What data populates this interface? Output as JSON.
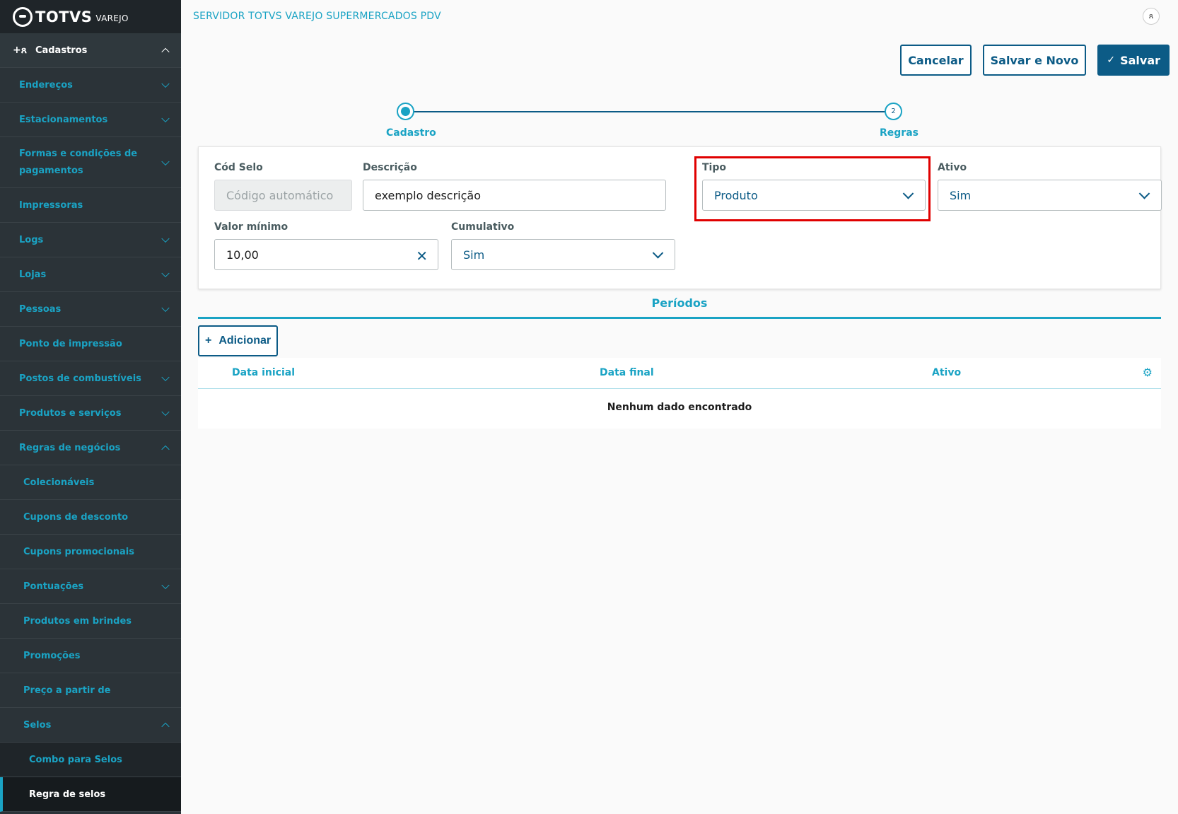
{
  "brand": {
    "name": "TOTVS",
    "sub": "VAREJO"
  },
  "header": {
    "title": "SERVIDOR TOTVS VAREJO SUPERMERCADOS PDV"
  },
  "sidebar": {
    "section": "Cadastros",
    "items": [
      {
        "label": "Endereços"
      },
      {
        "label": "Estacionamentos"
      },
      {
        "label": "Formas e condições de pagamentos"
      },
      {
        "label": "Impressoras"
      },
      {
        "label": "Logs"
      },
      {
        "label": "Lojas"
      },
      {
        "label": "Pessoas"
      },
      {
        "label": "Ponto de impressão"
      },
      {
        "label": "Postos de combustíveis"
      },
      {
        "label": "Produtos e serviços"
      },
      {
        "label": "Regras de negócios"
      }
    ],
    "sub_items": [
      {
        "label": "Colecionáveis"
      },
      {
        "label": "Cupons de desconto"
      },
      {
        "label": "Cupons promocionais"
      },
      {
        "label": "Pontuações"
      },
      {
        "label": "Produtos em brindes"
      },
      {
        "label": "Promoções"
      },
      {
        "label": "Preço a partir de"
      },
      {
        "label": "Selos"
      }
    ],
    "sub2_items": [
      {
        "label": "Combo para Selos"
      },
      {
        "label": "Regra de selos"
      }
    ]
  },
  "actions": {
    "cancel": "Cancelar",
    "save_new": "Salvar e Novo",
    "save": "Salvar"
  },
  "stepper": {
    "step1": "Cadastro",
    "step2": "Regras",
    "step2_number": "2"
  },
  "form": {
    "cod_selo": {
      "label": "Cód Selo",
      "placeholder": "Código automático"
    },
    "descricao": {
      "label": "Descrição",
      "value": "exemplo descrição"
    },
    "tipo": {
      "label": "Tipo",
      "value": "Produto"
    },
    "ativo": {
      "label": "Ativo",
      "value": "Sim"
    },
    "valor_minimo": {
      "label": "Valor mínimo",
      "value": "10,00"
    },
    "cumulativo": {
      "label": "Cumulativo",
      "value": "Sim"
    }
  },
  "periods": {
    "title": "Períodos",
    "add_label": "Adicionar",
    "columns": [
      "Data inicial",
      "Data final",
      "Ativo"
    ],
    "empty_text": "Nenhum dado encontrado"
  }
}
